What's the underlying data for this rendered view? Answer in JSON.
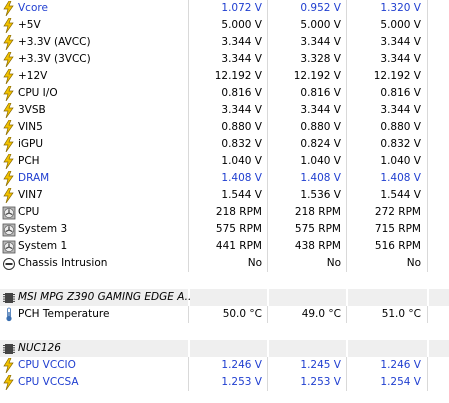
{
  "units": {
    "volt": "V",
    "rpm": "RPM",
    "celsius": "°C"
  },
  "voltages": [
    {
      "name": "Vcore",
      "current": "1.072",
      "min": "0.952",
      "max": "1.320",
      "blue": true
    },
    {
      "name": "+5V",
      "current": "5.000",
      "min": "5.000",
      "max": "5.000",
      "blue": false
    },
    {
      "name": "+3.3V (AVCC)",
      "current": "3.344",
      "min": "3.344",
      "max": "3.344",
      "blue": false
    },
    {
      "name": "+3.3V (3VCC)",
      "current": "3.344",
      "min": "3.328",
      "max": "3.344",
      "blue": false
    },
    {
      "name": "+12V",
      "current": "12.192",
      "min": "12.192",
      "max": "12.192",
      "blue": false
    },
    {
      "name": "CPU I/O",
      "current": "0.816",
      "min": "0.816",
      "max": "0.816",
      "blue": false
    },
    {
      "name": "3VSB",
      "current": "3.344",
      "min": "3.344",
      "max": "3.344",
      "blue": false
    },
    {
      "name": "VIN5",
      "current": "0.880",
      "min": "0.880",
      "max": "0.880",
      "blue": false
    },
    {
      "name": "iGPU",
      "current": "0.832",
      "min": "0.824",
      "max": "0.832",
      "blue": false
    },
    {
      "name": "PCH",
      "current": "1.040",
      "min": "1.040",
      "max": "1.040",
      "blue": false
    },
    {
      "name": "DRAM",
      "current": "1.408",
      "min": "1.408",
      "max": "1.408",
      "blue": true
    },
    {
      "name": "VIN7",
      "current": "1.544",
      "min": "1.536",
      "max": "1.544",
      "blue": false
    }
  ],
  "fans": [
    {
      "name": "CPU",
      "current": "218",
      "min": "218",
      "max": "272"
    },
    {
      "name": "System 3",
      "current": "575",
      "min": "575",
      "max": "715"
    },
    {
      "name": "System 1",
      "current": "441",
      "min": "438",
      "max": "516"
    }
  ],
  "intrusion": {
    "name": "Chassis Intrusion",
    "current": "No",
    "min": "No",
    "max": "No"
  },
  "board_section": {
    "label": "MSI MPG Z390 GAMING EDGE A..."
  },
  "pch_temp": {
    "name": "PCH Temperature",
    "current": "50.0",
    "min": "49.0",
    "max": "51.0"
  },
  "nuc_section": {
    "label": "NUC126"
  },
  "nuc_rows": [
    {
      "name": "CPU VCCIO",
      "current": "1.246",
      "min": "1.245",
      "max": "1.246"
    },
    {
      "name": "CPU VCCSA",
      "current": "1.253",
      "min": "1.253",
      "max": "1.254"
    }
  ],
  "colors": {
    "blue_text": "#1f3ed0",
    "section_bg": "#efefef",
    "bolt": "#f2c200"
  }
}
